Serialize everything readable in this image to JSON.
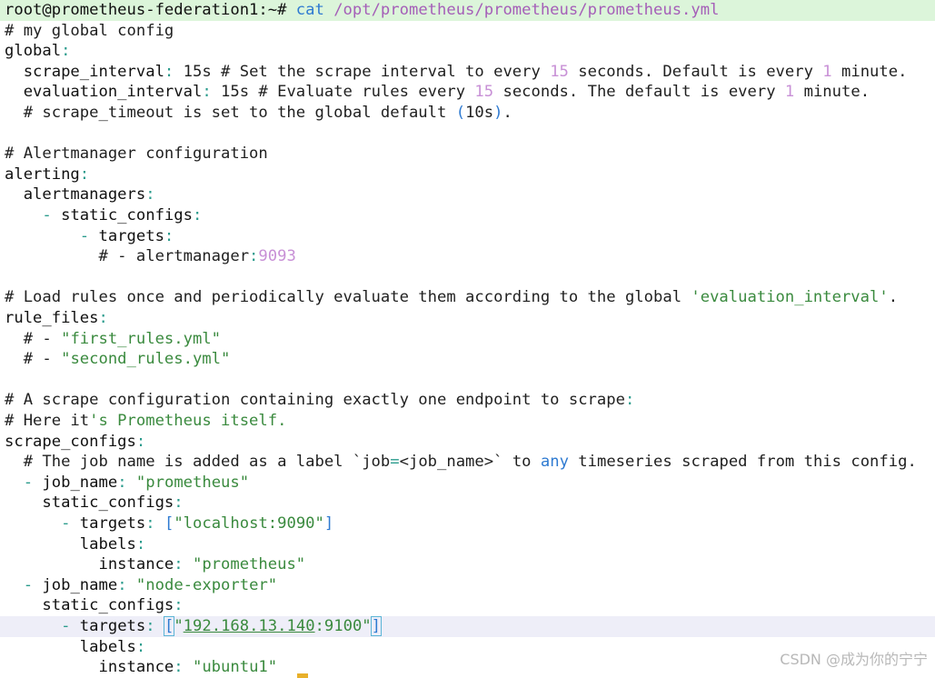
{
  "terminal": {
    "prompt": "root@prometheus-federation1:~#",
    "command": "cat",
    "path": "/opt/prometheus/prometheus/prometheus.yml",
    "watermark": "CSDN @成为你的宁宁"
  },
  "lines": [
    [
      {
        "t": "root@prometheus-federation1:~# ",
        "c": "prompt"
      },
      {
        "t": "cat ",
        "c": "cmd"
      },
      {
        "t": "/opt/prometheus/prometheus/prometheus.yml",
        "c": "path"
      }
    ],
    [
      {
        "t": "# my global config",
        "c": "comment"
      }
    ],
    [
      {
        "t": "global",
        "c": "key"
      },
      {
        "t": ":",
        "c": "punct"
      }
    ],
    [
      {
        "t": "  scrape_interval",
        "c": "key"
      },
      {
        "t": ":",
        "c": "punct"
      },
      {
        "t": " 15s # Set the scrape interval to every ",
        "c": "comment"
      },
      {
        "t": "15",
        "c": "num"
      },
      {
        "t": " seconds. Default is every ",
        "c": "comment"
      },
      {
        "t": "1",
        "c": "num"
      },
      {
        "t": " minute.",
        "c": "comment"
      }
    ],
    [
      {
        "t": "  evaluation_interval",
        "c": "key"
      },
      {
        "t": ":",
        "c": "punct"
      },
      {
        "t": " 15s # Evaluate rules every ",
        "c": "comment"
      },
      {
        "t": "15",
        "c": "num"
      },
      {
        "t": " seconds. The default is every ",
        "c": "comment"
      },
      {
        "t": "1",
        "c": "num"
      },
      {
        "t": " minute.",
        "c": "comment"
      }
    ],
    [
      {
        "t": "  # scrape_timeout is set to the global default ",
        "c": "comment"
      },
      {
        "t": "(",
        "c": "kw"
      },
      {
        "t": "10s",
        "c": "comment"
      },
      {
        "t": ")",
        "c": "kw"
      },
      {
        "t": ".",
        "c": "comment"
      }
    ],
    [],
    [
      {
        "t": "# Alertmanager configuration",
        "c": "comment"
      }
    ],
    [
      {
        "t": "alerting",
        "c": "key"
      },
      {
        "t": ":",
        "c": "punct"
      }
    ],
    [
      {
        "t": "  alertmanagers",
        "c": "key"
      },
      {
        "t": ":",
        "c": "punct"
      }
    ],
    [
      {
        "t": "    - ",
        "c": "punct"
      },
      {
        "t": "static_configs",
        "c": "key"
      },
      {
        "t": ":",
        "c": "punct"
      }
    ],
    [
      {
        "t": "        - ",
        "c": "punct"
      },
      {
        "t": "targets",
        "c": "key"
      },
      {
        "t": ":",
        "c": "punct"
      }
    ],
    [
      {
        "t": "          # - alertmanager",
        "c": "comment"
      },
      {
        "t": ":",
        "c": "punct"
      },
      {
        "t": "9093",
        "c": "num"
      }
    ],
    [],
    [
      {
        "t": "# Load rules once and periodically evaluate them according to the global ",
        "c": "comment"
      },
      {
        "t": "'evaluation_interval'",
        "c": "str"
      },
      {
        "t": ".",
        "c": "comment"
      }
    ],
    [
      {
        "t": "rule_files",
        "c": "key"
      },
      {
        "t": ":",
        "c": "punct"
      }
    ],
    [
      {
        "t": "  # - ",
        "c": "comment"
      },
      {
        "t": "\"first_rules.yml\"",
        "c": "str"
      }
    ],
    [
      {
        "t": "  # - ",
        "c": "comment"
      },
      {
        "t": "\"second_rules.yml\"",
        "c": "str"
      }
    ],
    [],
    [
      {
        "t": "# A scrape configuration containing exactly one endpoint to scrape",
        "c": "comment"
      },
      {
        "t": ":",
        "c": "punct"
      }
    ],
    [
      {
        "t": "# Here it",
        "c": "comment"
      },
      {
        "t": "'s Prometheus itself.",
        "c": "str"
      }
    ],
    [
      {
        "t": "scrape_configs",
        "c": "key"
      },
      {
        "t": ":",
        "c": "punct"
      }
    ],
    [
      {
        "t": "  # The job name is added as a label `job",
        "c": "comment"
      },
      {
        "t": "=",
        "c": "punct"
      },
      {
        "t": "<job_name>",
        "c": "comment"
      },
      {
        "t": "`",
        "c": "comment"
      },
      {
        "t": " to ",
        "c": "comment"
      },
      {
        "t": "any",
        "c": "kw"
      },
      {
        "t": " timeseries scraped from this config.",
        "c": "comment"
      }
    ],
    [
      {
        "t": "  - ",
        "c": "punct"
      },
      {
        "t": "job_name",
        "c": "key"
      },
      {
        "t": ":",
        "c": "punct"
      },
      {
        "t": " ",
        "c": "comment"
      },
      {
        "t": "\"prometheus\"",
        "c": "str"
      }
    ],
    [
      {
        "t": "    static_configs",
        "c": "key"
      },
      {
        "t": ":",
        "c": "punct"
      }
    ],
    [
      {
        "t": "      - ",
        "c": "punct"
      },
      {
        "t": "targets",
        "c": "key"
      },
      {
        "t": ":",
        "c": "punct"
      },
      {
        "t": " ",
        "c": "comment"
      },
      {
        "t": "[",
        "c": "bracket"
      },
      {
        "t": "\"localhost:9090\"",
        "c": "str"
      },
      {
        "t": "]",
        "c": "bracket"
      }
    ],
    [
      {
        "t": "        labels",
        "c": "key"
      },
      {
        "t": ":",
        "c": "punct"
      }
    ],
    [
      {
        "t": "          instance",
        "c": "key"
      },
      {
        "t": ":",
        "c": "punct"
      },
      {
        "t": " ",
        "c": "comment"
      },
      {
        "t": "\"prometheus\"",
        "c": "str"
      }
    ],
    [
      {
        "t": "  - ",
        "c": "punct"
      },
      {
        "t": "job_name",
        "c": "key"
      },
      {
        "t": ":",
        "c": "punct"
      },
      {
        "t": " ",
        "c": "comment"
      },
      {
        "t": "\"node-exporter\"",
        "c": "str"
      }
    ],
    [
      {
        "t": "    static_configs",
        "c": "key"
      },
      {
        "t": ":",
        "c": "punct"
      }
    ],
    [
      {
        "t": "      - ",
        "c": "punct"
      },
      {
        "t": "targets",
        "c": "key"
      },
      {
        "t": ":",
        "c": "punct"
      },
      {
        "t": " ",
        "c": "comment"
      },
      {
        "t": "[",
        "c": "bracketbox"
      },
      {
        "t": "\"",
        "c": "str"
      },
      {
        "t": "192.168.13.140",
        "c": "ip"
      },
      {
        "t": ":9100\"",
        "c": "str"
      },
      {
        "t": "]",
        "c": "bracketbox"
      }
    ],
    [
      {
        "t": "        labels",
        "c": "key"
      },
      {
        "t": ":",
        "c": "punct"
      }
    ],
    [
      {
        "t": "          instance",
        "c": "key"
      },
      {
        "t": ":",
        "c": "punct"
      },
      {
        "t": " ",
        "c": "comment"
      },
      {
        "t": "\"ubuntu1\"",
        "c": "str"
      }
    ]
  ],
  "colors": {
    "prompt_line_bg": "#dcf5da",
    "highlight_line_bg": "#eeeef8",
    "string": "#3a8a3e",
    "number": "#c890d6",
    "keyword": "#2e7ad1",
    "punctuation": "#2a9b8c",
    "cursor": "#e8b02a"
  }
}
